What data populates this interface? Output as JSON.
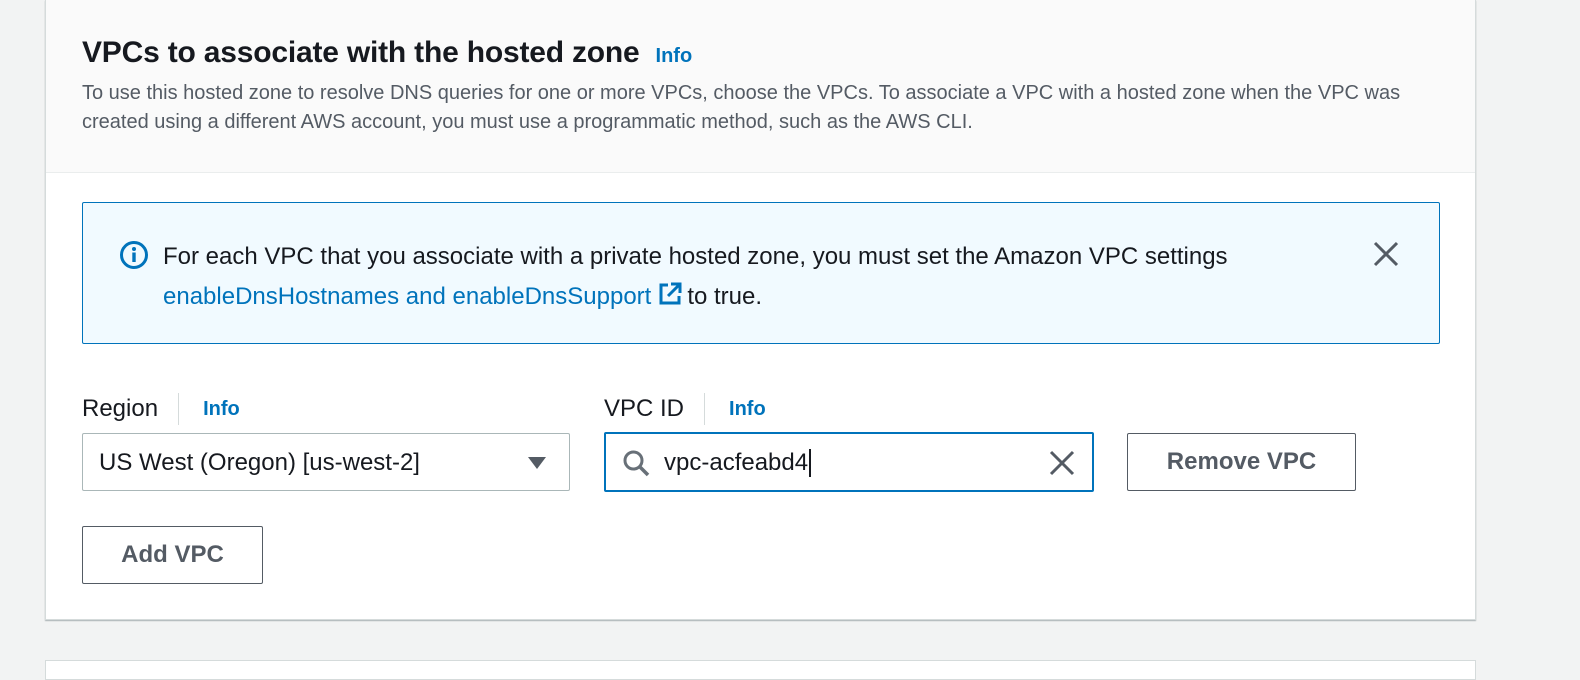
{
  "section": {
    "title": "VPCs to associate with the hosted zone",
    "info_label": "Info",
    "description": "To use this hosted zone to resolve DNS queries for one or more VPCs, choose the VPCs. To associate a VPC with a hosted zone when the VPC was created using a different AWS account, you must use a programmatic method, such as the AWS CLI."
  },
  "alert": {
    "text_before": "For each VPC that you associate with a private hosted zone, you must set the Amazon VPC settings",
    "link_text": "enableDnsHostnames and enableDnsSupport",
    "text_after": "to true.",
    "icon": "info-circle-icon",
    "close_icon": "close-icon"
  },
  "region_field": {
    "label": "Region",
    "info_label": "Info",
    "selected_value": "US West (Oregon) [us-west-2]"
  },
  "vpc_field": {
    "label": "VPC ID",
    "info_label": "Info",
    "value": "vpc-acfeabd4"
  },
  "buttons": {
    "remove_vpc": "Remove VPC",
    "add_vpc": "Add VPC"
  },
  "colors": {
    "accent": "#0073bb",
    "alert_bg": "#f1faff",
    "text": "#16191f",
    "muted_text": "#545b64"
  }
}
